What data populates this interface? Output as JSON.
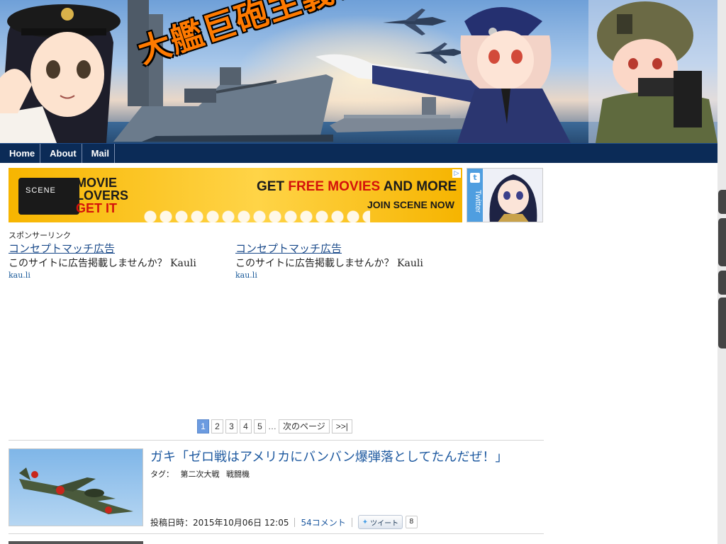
{
  "banner": {
    "title": "大艦巨砲主義！"
  },
  "nav": {
    "items": [
      "Home",
      "About",
      "Mail"
    ]
  },
  "ads": {
    "banner": {
      "scene_logo": "SCENE",
      "movie_line1": "MOVIE",
      "movie_line2": "LOVERS",
      "movie_line3": "GET IT",
      "headline_part1": "GET ",
      "headline_red": "FREE MOVIES",
      "headline_part2": " AND MORE",
      "subline": "JOIN SCENE NOW"
    },
    "twitter_label": "Twitter",
    "sponsor_label": "スポンサーリンク",
    "sponsored": [
      {
        "title": "コンセプトマッチ広告",
        "desc": "このサイトに広告掲載しませんか？ Kauli",
        "url": "kau.li"
      },
      {
        "title": "コンセプトマッチ広告",
        "desc": "このサイトに広告掲載しませんか？ Kauli",
        "url": "kau.li"
      }
    ]
  },
  "pagination": {
    "pages": [
      "1",
      "2",
      "3",
      "4",
      "5"
    ],
    "current": "1",
    "ellipsis": "…",
    "next": "次のページ",
    "last": ">>|"
  },
  "posts": [
    {
      "title": "ガキ「ゼロ戦はアメリカにバンバン爆弾落としてたんだぜ！」",
      "tags_label": "タグ：",
      "tags": [
        "第二次大戦",
        "戦闘機"
      ],
      "posted": "投稿日時：2015年10月06日 12:05",
      "comments": "54コメント",
      "tweet_label": "ツイート",
      "tweet_count": "8"
    }
  ],
  "colors": {
    "nav_bg": "#0b2b57",
    "link": "#1f5aa0",
    "pagination_active": "#6c9be0",
    "banner_title": "#ff7a00"
  }
}
